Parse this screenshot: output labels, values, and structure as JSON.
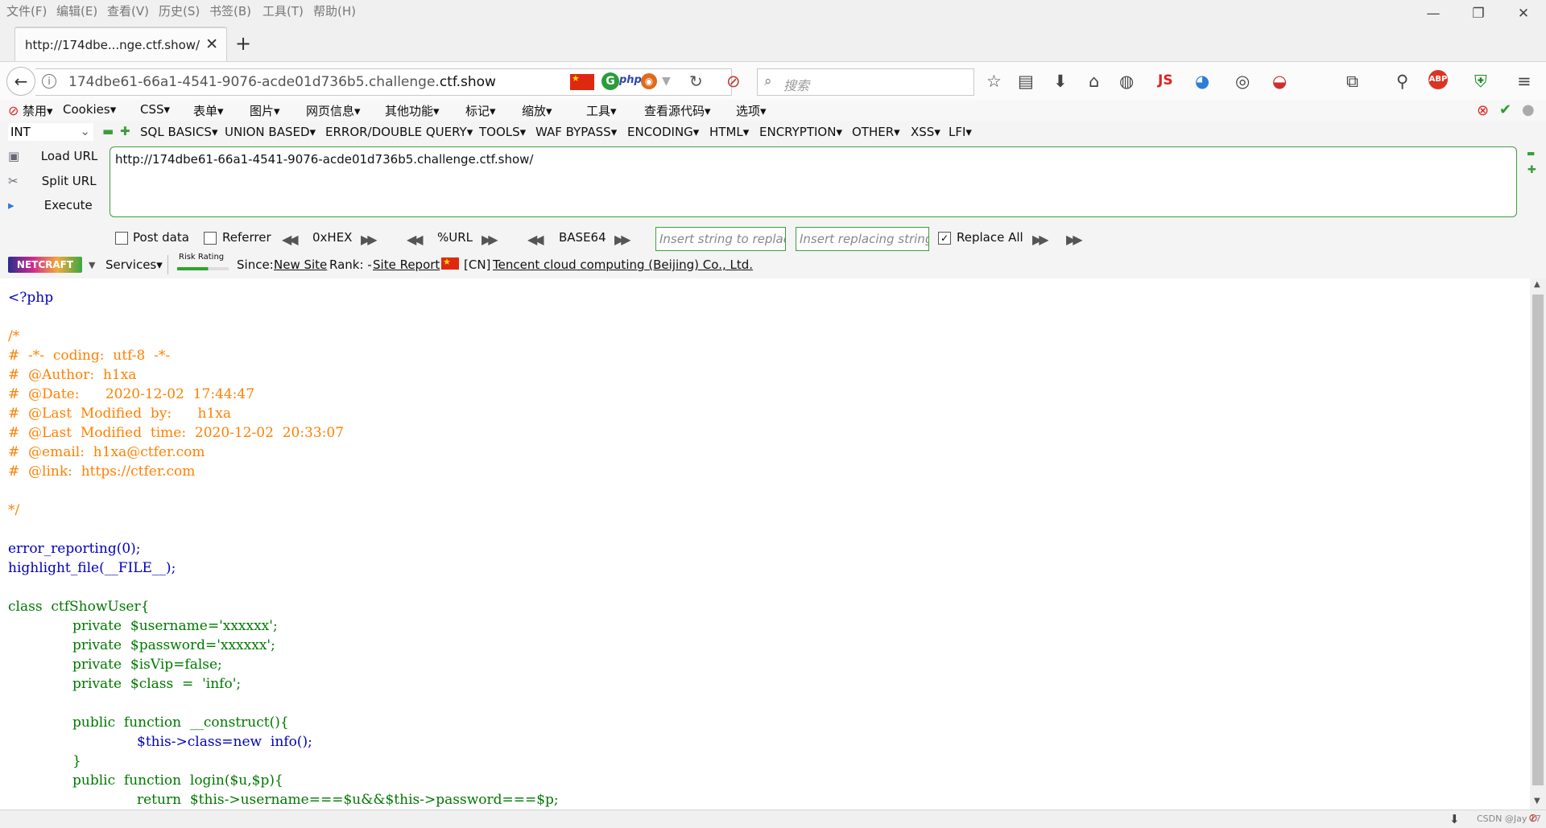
{
  "menubar": {
    "items": [
      "文件(F)",
      "编辑(E)",
      "查看(V)",
      "历史(S)",
      "书签(B)",
      "工具(T)",
      "帮助(H)"
    ]
  },
  "window_controls": {
    "minimize": "—",
    "restore": "❐",
    "close": "✕"
  },
  "tab": {
    "title": "http://174dbe...nge.ctf.show/",
    "close": "✕",
    "new_tab": "+"
  },
  "navbar": {
    "url_prefix": "174dbe61-66a1-4541-9076-acde01d736b5.challenge.",
    "url_domain": "ctf.show",
    "search_placeholder": "搜索",
    "php_badge": "php",
    "js_badge": "JS"
  },
  "bookmarks_bar": {
    "items": [
      "禁用▾",
      "Cookies▾",
      "CSS▾",
      "表单▾",
      "图片▾",
      "网页信息▾",
      "其他功能▾",
      "标记▾",
      "缩放▾",
      "工具▾",
      "查看源代码▾",
      "选项▾"
    ]
  },
  "hackbar": {
    "type_select": "INT",
    "menus": [
      "SQL BASICS▾",
      "UNION BASED▾",
      "ERROR/DOUBLE QUERY▾",
      "TOOLS▾",
      "WAF BYPASS▾",
      "ENCODING▾",
      "HTML▾",
      "ENCRYPTION▾",
      "OTHER▾",
      "XSS▾",
      "LFI▾"
    ],
    "load_url": "Load URL",
    "split_url": "Split URL",
    "execute": "Execute",
    "url_value": "http://174dbe61-66a1-4541-9076-acde01d736b5.challenge.ctf.show/",
    "post_data": "Post data",
    "referrer": "Referrer",
    "hex": "0xHEX",
    "urlenc": "%URL",
    "base64": "BASE64",
    "insert_placeholder": "Insert string to replace",
    "replacing_placeholder": "Insert replacing string",
    "replace_all": "Replace All",
    "post_checked": false,
    "referrer_checked": false,
    "replace_all_checked": true
  },
  "netcraft": {
    "logo": "NETCRAFT",
    "services": "Services▾",
    "risk": "Risk Rating",
    "since_label": "Since:",
    "since_value": "New Site",
    "rank_label": "Rank: -",
    "site_report": "Site Report",
    "country": "[CN]",
    "hoster": "Tencent cloud computing (Beijing) Co., Ltd."
  },
  "code_lines": [
    {
      "t": "<?php",
      "c": "html",
      "i": 0
    },
    {
      "t": "",
      "c": "html",
      "i": 0
    },
    {
      "t": "/*",
      "c": "com",
      "i": 0
    },
    {
      "t": "#  -*-  coding:  utf-8  -*-",
      "c": "com",
      "i": 0
    },
    {
      "t": "#  @Author:  h1xa",
      "c": "com",
      "i": 0
    },
    {
      "t": "#  @Date:      2020-12-02  17:44:47",
      "c": "com",
      "i": 0
    },
    {
      "t": "#  @Last  Modified  by:      h1xa",
      "c": "com",
      "i": 0
    },
    {
      "t": "#  @Last  Modified  time:  2020-12-02  20:33:07",
      "c": "com",
      "i": 0
    },
    {
      "t": "#  @email:  h1xa@ctfer.com",
      "c": "com",
      "i": 0
    },
    {
      "t": "#  @link:  https://ctfer.com",
      "c": "com",
      "i": 0
    },
    {
      "t": "",
      "c": "com",
      "i": 0
    },
    {
      "t": "*/",
      "c": "com",
      "i": 0
    },
    {
      "t": "",
      "c": "html",
      "i": 0
    },
    {
      "t": "error_reporting(0);",
      "c": "def",
      "i": 0
    },
    {
      "t": "highlight_file(__FILE__);",
      "c": "def",
      "i": 0
    },
    {
      "t": "",
      "c": "html",
      "i": 0
    },
    {
      "t": "class  ctfShowUser{",
      "c": "kw",
      "i": 0
    },
    {
      "t": "private  $username='xxxxxx';",
      "c": "kw",
      "i": 1
    },
    {
      "t": "private  $password='xxxxxx';",
      "c": "kw",
      "i": 1
    },
    {
      "t": "private  $isVip=false;",
      "c": "kw",
      "i": 1
    },
    {
      "t": "private  $class  =  'info';",
      "c": "kw",
      "i": 1
    },
    {
      "t": "",
      "c": "html",
      "i": 0
    },
    {
      "t": "public  function  __construct(){",
      "c": "kw",
      "i": 1
    },
    {
      "t": "$this->class=new  info();",
      "c": "def",
      "i": 2
    },
    {
      "t": "}",
      "c": "kw",
      "i": 1
    },
    {
      "t": "public  function  login($u,$p){",
      "c": "kw",
      "i": 1
    },
    {
      "t": "return  $this->username===$u&&$this->password===$p;",
      "c": "kw",
      "i": 2
    }
  ],
  "status": {
    "watermark": "CSDN @Jay 17"
  },
  "colors": {
    "comment": "#ff8000",
    "keyword": "#007700",
    "default": "#0000bb",
    "string": "#dd0000",
    "hackbar_border": "#3d9e3d"
  }
}
